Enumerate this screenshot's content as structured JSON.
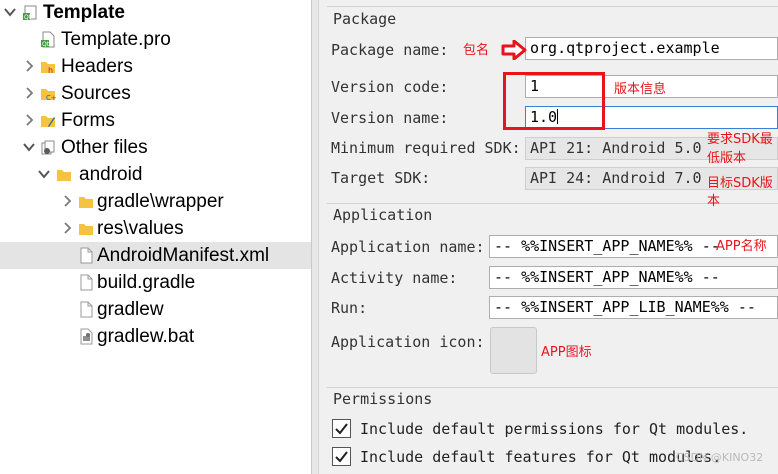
{
  "tree": {
    "items": [
      {
        "label": "Template",
        "bold": true,
        "arrow": "down",
        "icon": "project-icon",
        "level": 0
      },
      {
        "label": "Template.pro",
        "arrow": "none",
        "icon": "pro-file-icon",
        "level": 1
      },
      {
        "label": "Headers",
        "arrow": "right",
        "icon": "headers-folder-icon",
        "level": 1
      },
      {
        "label": "Sources",
        "arrow": "right",
        "icon": "sources-folder-icon",
        "level": 1
      },
      {
        "label": "Forms",
        "arrow": "right",
        "icon": "forms-folder-icon",
        "level": 1
      },
      {
        "label": "Other files",
        "arrow": "down",
        "icon": "other-files-icon",
        "level": 1
      },
      {
        "label": "android",
        "arrow": "down",
        "icon": "folder-icon",
        "level": 2
      },
      {
        "label": "gradle\\wrapper",
        "arrow": "right",
        "icon": "folder-icon",
        "level": 3
      },
      {
        "label": "res\\values",
        "arrow": "right",
        "icon": "folder-icon",
        "level": 3
      },
      {
        "label": "AndroidManifest.xml",
        "arrow": "none",
        "icon": "file-icon",
        "level": 3,
        "selected": true
      },
      {
        "label": "build.gradle",
        "arrow": "none",
        "icon": "file-icon",
        "level": 3
      },
      {
        "label": "gradlew",
        "arrow": "none",
        "icon": "file-icon",
        "level": 3
      },
      {
        "label": "gradlew.bat",
        "arrow": "none",
        "icon": "bat-file-icon",
        "level": 3
      }
    ]
  },
  "package": {
    "title": "Package",
    "package_name_label": "Package name:",
    "package_name_value": "org.qtproject.example",
    "version_code_label": "Version code:",
    "version_code_value": "1",
    "version_name_label": "Version name:",
    "version_name_value": "1.0",
    "min_sdk_label": "Minimum required SDK:",
    "min_sdk_value": "API 21: Android 5.0",
    "target_sdk_label": "Target SDK:",
    "target_sdk_value": "API 24: Android 7.0"
  },
  "application": {
    "title": "Application",
    "app_name_label": "Application name:",
    "app_name_value": "-- %%INSERT_APP_NAME%% --",
    "activity_name_label": "Activity name:",
    "activity_name_value": "-- %%INSERT_APP_NAME%% --",
    "run_label": "Run:",
    "run_value": "-- %%INSERT_APP_LIB_NAME%% --",
    "icon_label": "Application icon:"
  },
  "permissions": {
    "title": "Permissions",
    "default_permissions_label": "Include default permissions for Qt modules.",
    "default_permissions_checked": true,
    "default_features_label": "Include default features for Qt modules.",
    "default_features_checked": true
  },
  "annotations": {
    "package_name": "包名",
    "version_info": "版本信息",
    "min_sdk_line1": "要求SDK最",
    "min_sdk_line2": "低版本",
    "target_sdk_line1": "目标SDK版",
    "target_sdk_line2": "本",
    "app_name": "APP名称",
    "app_icon": "APP图标",
    "color": "#e8141b"
  },
  "watermark": "CSDN @KINO32"
}
